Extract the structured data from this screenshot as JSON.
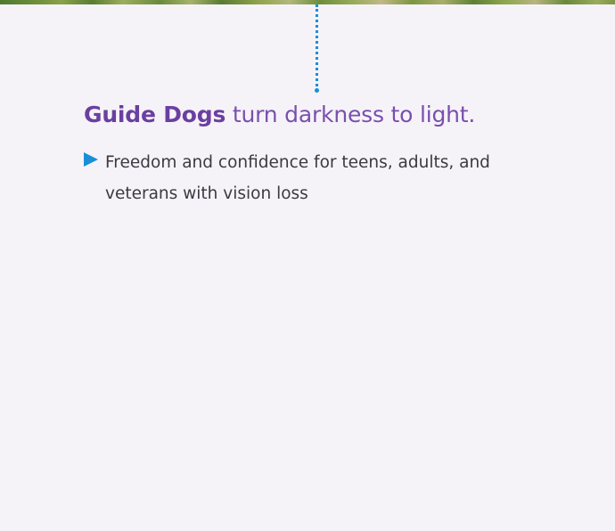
{
  "headline": {
    "bold": "Guide Dogs",
    "rest": " turn darkness to light."
  },
  "bullets": [
    {
      "text": "Freedom and confidence for teens, adults, and veterans with vision loss"
    }
  ],
  "colors": {
    "headline": "#6b3fa0",
    "accent": "#1a8fd6",
    "body_text": "#3c3a40",
    "background": "#f5f3f8"
  },
  "icons": {
    "bullet": "triangle-right-icon"
  }
}
